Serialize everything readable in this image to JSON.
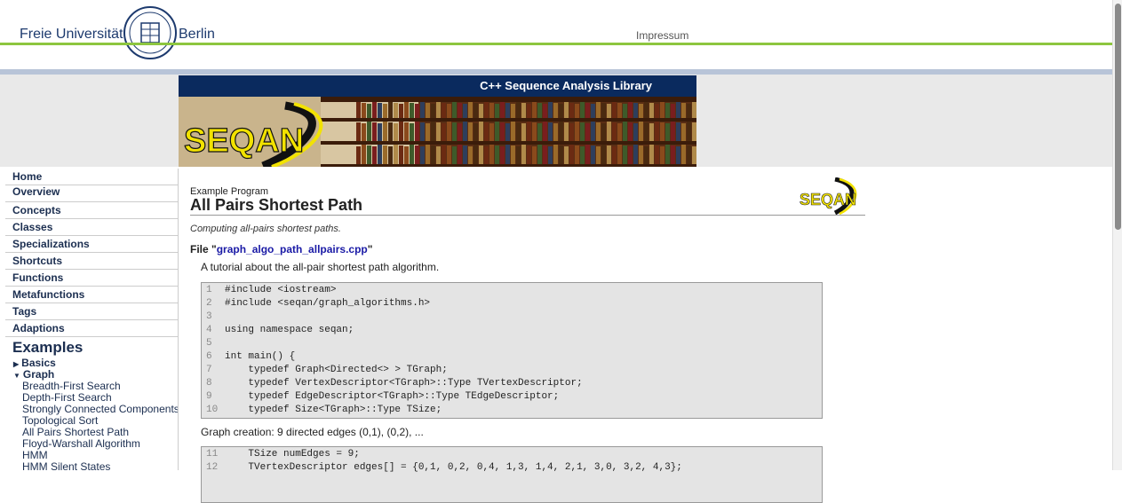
{
  "header": {
    "university_left": "Freie Universität",
    "university_right": "Berlin",
    "impressum": "Impressum"
  },
  "banner": {
    "title": "C++ Sequence Analysis Library",
    "logo_text": "SEQAN"
  },
  "sidebar": {
    "nav": [
      "Home",
      "Overview",
      "Concepts",
      "Classes",
      "Specializations",
      "Shortcuts",
      "Functions",
      "Metafunctions",
      "Tags",
      "Adaptions"
    ],
    "examples_title": "Examples",
    "groups": [
      {
        "label": "Basics",
        "expanded": false
      },
      {
        "label": "Graph",
        "expanded": true
      }
    ],
    "graph_items": [
      "Breadth-First Search",
      "Depth-First Search",
      "Strongly Connected Components",
      "Topological Sort",
      "All Pairs Shortest Path",
      "Floyd-Warshall Algorithm",
      "HMM",
      "HMM Silent States"
    ]
  },
  "main": {
    "label": "Example Program",
    "title": "All Pairs Shortest Path",
    "subtitle": "Computing all-pairs shortest paths.",
    "file_prefix": "File \"",
    "file_name": "graph_algo_path_allpairs.cpp",
    "file_suffix": "\"",
    "tutorial": "A tutorial about the all-pair shortest path algorithm.",
    "graph_creation": "Graph creation: 9 directed edges (0,1), (0,2), ...",
    "code1": [
      {
        "n": "1",
        "c": "#include <iostream>"
      },
      {
        "n": "2",
        "c": "#include <seqan/graph_algorithms.h>"
      },
      {
        "n": "3",
        "c": ""
      },
      {
        "n": "4",
        "c": "using namespace seqan;"
      },
      {
        "n": "5",
        "c": ""
      },
      {
        "n": "6",
        "c": "int main() {"
      },
      {
        "n": "7",
        "c": "    typedef Graph<Directed<> > TGraph;"
      },
      {
        "n": "8",
        "c": "    typedef VertexDescriptor<TGraph>::Type TVertexDescriptor;"
      },
      {
        "n": "9",
        "c": "    typedef EdgeDescriptor<TGraph>::Type TEdgeDescriptor;"
      },
      {
        "n": "10",
        "c": "    typedef Size<TGraph>::Type TSize;"
      }
    ],
    "code2": [
      {
        "n": "11",
        "c": "    TSize numEdges = 9;"
      },
      {
        "n": "12",
        "c": "    TVertexDescriptor edges[] = {0,1, 0,2, 0,4, 1,3, 1,4, 2,1, 3,0, 3,2, 4,3};"
      }
    ]
  },
  "colors": {
    "navy": "#0a2a5e",
    "green": "#8dc63f",
    "link": "#1a1aa6",
    "logo_yellow": "#f2e200"
  }
}
